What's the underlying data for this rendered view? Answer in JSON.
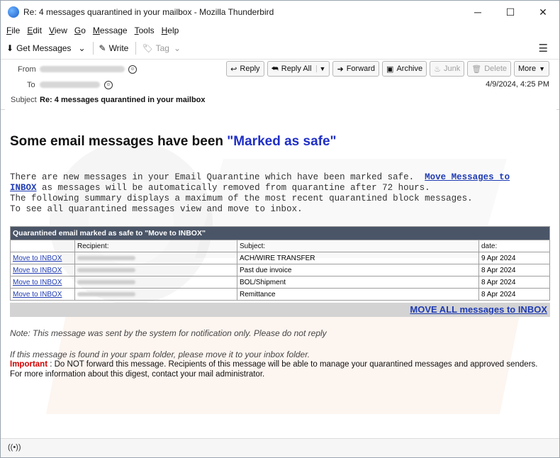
{
  "window": {
    "title": "Re: 4 messages quarantined in your mailbox - Mozilla Thunderbird",
    "controls": {
      "minimize": "─",
      "maximize": "☐",
      "close": "✕"
    }
  },
  "menu": [
    "File",
    "Edit",
    "View",
    "Go",
    "Message",
    "Tools",
    "Help"
  ],
  "menu_access_keys": [
    "F",
    "E",
    "V",
    "G",
    "M",
    "T",
    "H"
  ],
  "toolbar": {
    "get_messages": "Get Messages",
    "write": "Write",
    "tag": "Tag"
  },
  "header": {
    "from_label": "From",
    "to_label": "To",
    "subject_label": "Subject",
    "subject": "Re: 4 messages quarantined in your mailbox",
    "date": "4/9/2024, 4:25 PM",
    "actions": {
      "reply": "Reply",
      "reply_all": "Reply All",
      "forward": "Forward",
      "archive": "Archive",
      "junk": "Junk",
      "delete": "Delete",
      "more": "More"
    }
  },
  "message": {
    "headline_prefix": "Some email messages have been ",
    "headline_highlight": "\"Marked as safe\"",
    "para1_start": "There are new messages in your Email Quarantine which have been marked safe.  ",
    "para1_link1": "Move Messages to",
    "para1_link2": "INBOX",
    "para1_end": " as messages will be automatically removed from quarantine after 72 hours.",
    "para2": "The following summary displays a maximum of the most recent quarantined block messages.",
    "para3": "To see all quarantined messages view and move to inbox.",
    "table": {
      "caption": "Quarantined email marked as safe to \"Move to INBOX\"",
      "headers": [
        "",
        "Recipient:",
        "Subject:",
        "date:"
      ],
      "rows": [
        {
          "action": "Move to INBOX",
          "subject": "ACH/WIRE TRANSFER",
          "date": "9 Apr 2024"
        },
        {
          "action": "Move to INBOX",
          "subject": "Past due invoice",
          "date": "8 Apr 2024"
        },
        {
          "action": "Move to INBOX",
          "subject": "BOL/Shipment",
          "date": "8 Apr 2024"
        },
        {
          "action": "Move to INBOX",
          "subject": "Remittance",
          "date": "8 Apr 2024"
        }
      ],
      "move_all": "MOVE ALL messages to INBOX"
    },
    "note": "Note: This message was sent by the system for notification only. Please do not reply",
    "spam_note": "If this message is found in your spam folder, please move it to your inbox folder.",
    "important_label": "Important",
    "important_text": " : Do NOT forward this message. Recipients of this message will be able to manage your quarantined messages and approved senders. For more information about this digest, contact your mail administrator."
  },
  "status": {
    "icon": "((•))"
  },
  "colors": {
    "accent_link": "#1f3bb3",
    "headline_highlight": "#1f2fc7",
    "table_caption_bg": "#4a5567",
    "important": "#d00000"
  }
}
